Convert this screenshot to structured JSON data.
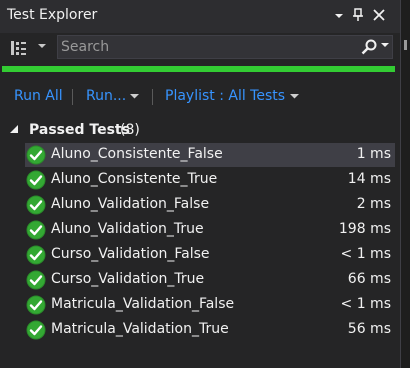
{
  "window": {
    "title": "Test Explorer",
    "controls": {
      "menu_glyph": "▾",
      "pin_glyph": "📌",
      "close_glyph": "✕"
    }
  },
  "toolbar": {
    "group_by_icon": "group-by-icon",
    "search": {
      "placeholder": "Search",
      "value": ""
    }
  },
  "progress": {
    "fraction": 1.0,
    "color": "#33cc33"
  },
  "actions": {
    "run_all": "Run All",
    "run": "Run...",
    "playlist": "Playlist : All Tests"
  },
  "group": {
    "title": "Passed Tests",
    "count": "(8)"
  },
  "tests": [
    {
      "name": "Aluno_Consistente_False",
      "duration": "1 ms"
    },
    {
      "name": "Aluno_Consistente_True",
      "duration": "14 ms"
    },
    {
      "name": "Aluno_Validation_False",
      "duration": "2 ms"
    },
    {
      "name": "Aluno_Validation_True",
      "duration": "198 ms"
    },
    {
      "name": "Curso_Validation_False",
      "duration": "< 1 ms"
    },
    {
      "name": "Curso_Validation_True",
      "duration": "66 ms"
    },
    {
      "name": "Matricula_Validation_False",
      "duration": "< 1 ms"
    },
    {
      "name": "Matricula_Validation_True",
      "duration": "56 ms"
    }
  ],
  "colors": {
    "link": "#3794ff",
    "pass": "#33a833",
    "background": "#252526",
    "selected_row": "#3f3f46"
  }
}
